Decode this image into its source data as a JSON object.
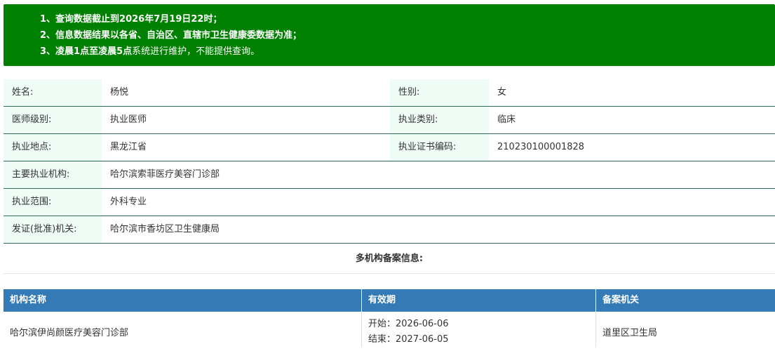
{
  "notice": [
    {
      "num": "1、",
      "parts": [
        {
          "text": "查询数据截止到2026年7月19日22时；",
          "bold": true
        }
      ]
    },
    {
      "num": "2、",
      "parts": [
        {
          "text": "信息数据结果以各省、自治区、直辖市卫生健康委数据为准；",
          "bold": true
        }
      ]
    },
    {
      "num": "3、",
      "parts": [
        {
          "text": "凌晨1点至凌晨5点",
          "bold": true
        },
        {
          "text": "系统进行维护，不能提供查询。",
          "bold": false
        }
      ]
    }
  ],
  "doctor": {
    "name_label": "姓名:",
    "name": "杨悦",
    "gender_label": "性别:",
    "gender": "女",
    "level_label": "医师级别:",
    "level": "执业医师",
    "category_label": "执业类别:",
    "category": "临床",
    "location_label": "执业地点:",
    "location": "黑龙江省",
    "cert_label": "执业证书编码:",
    "cert": "210230100001828",
    "institution_label": "主要执业机构:",
    "institution": "哈尔滨索菲医疗美容门诊部",
    "scope_label": "执业范围:",
    "scope": "外科专业",
    "authority_label": "发证(批准)机关:",
    "authority": "哈尔滨市香坊区卫生健康局"
  },
  "multi_title": "多机构备案信息:",
  "registry": {
    "headers": [
      "机构名称",
      "有效期",
      "备案机关"
    ],
    "rows": [
      {
        "name": "哈尔滨伊尚颜医疗美容门诊部",
        "start": "开始：2026-06-06",
        "end": "结束：2027-06-05",
        "agency": "道里区卫生局"
      }
    ]
  }
}
